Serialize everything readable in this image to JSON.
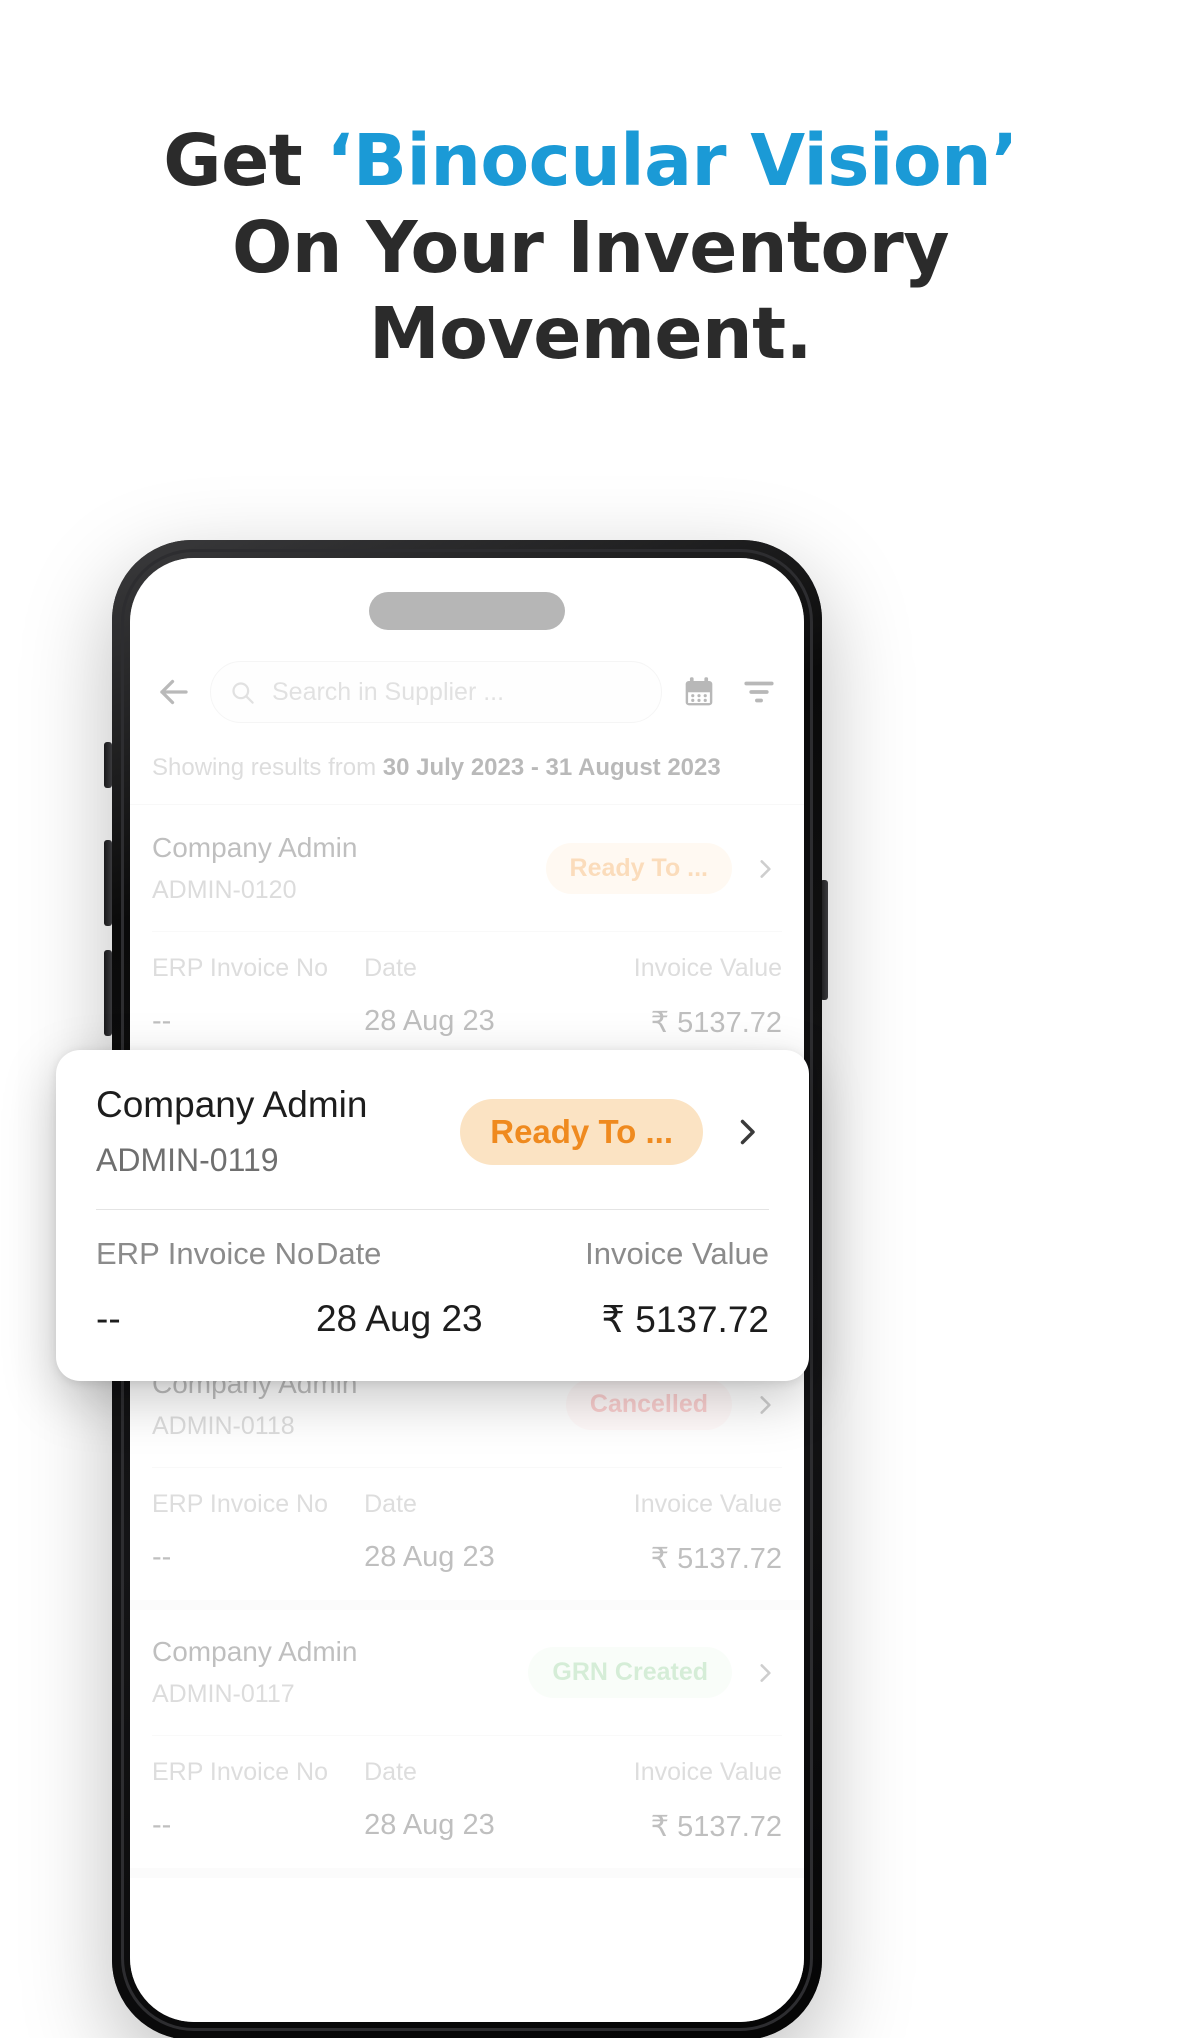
{
  "headline": {
    "line1_before": "Get ",
    "line1_accent": "‘Binocular Vision’",
    "line2": "On Your Inventory",
    "line3": "Movement.",
    "accent_color": "#1b9ad6",
    "text_color": "#2b2b2b"
  },
  "appbar": {
    "back_icon": "back-arrow-icon",
    "search_icon": "search-icon",
    "search_placeholder": "Search in Supplier ...",
    "search_value": "",
    "calendar_icon": "calendar-icon",
    "filter_icon": "filter-icon"
  },
  "results_summary": {
    "prefix": "Showing results from ",
    "range": "30 July 2023 - 31 August 2023"
  },
  "table_labels": {
    "erp_invoice_no": "ERP Invoice No",
    "date": "Date",
    "invoice_value": "Invoice Value"
  },
  "highlight_card": {
    "title": "Company Admin",
    "code": "ADMIN-0119",
    "status": "Ready To ...",
    "status_color": "#ef8a1f",
    "status_bg": "#fbe3c3",
    "chevron_icon": "chevron-right-icon",
    "erp_invoice_no_label": "ERP Invoice No",
    "erp_invoice_no_value": "--",
    "date_label": "Date",
    "date_value": "28 Aug 23",
    "invoice_value_label": "Invoice Value",
    "invoice_value_value": "₹ 5137.72"
  },
  "rows": [
    {
      "title": "Company Admin",
      "code": "ADMIN-0120",
      "status": "Ready To ...",
      "status_kind": "amber",
      "erp_invoice_no_label": "ERP Invoice No",
      "erp_invoice_no_value": "--",
      "date_label": "Date",
      "date_value": "28 Aug 23",
      "invoice_value_label": "Invoice Value",
      "invoice_value_value": "₹ 5137.72"
    },
    {
      "title": "Company Admin",
      "code": "ADMIN-0119",
      "status": "Ready To ...",
      "status_kind": "amber",
      "erp_invoice_no_label": "ERP Invoice No",
      "erp_invoice_no_value": "--",
      "date_label": "Date",
      "date_value": "28 Aug 23",
      "invoice_value_label": "Invoice Value",
      "invoice_value_value": "₹ 5137.72"
    },
    {
      "title": "Company Admin",
      "code": "ADMIN-0118",
      "status": "Cancelled",
      "status_kind": "red",
      "erp_invoice_no_label": "ERP Invoice No",
      "erp_invoice_no_value": "--",
      "date_label": "Date",
      "date_value": "28 Aug 23",
      "invoice_value_label": "Invoice Value",
      "invoice_value_value": "₹ 5137.72"
    },
    {
      "title": "Company Admin",
      "code": "ADMIN-0117",
      "status": "GRN Created",
      "status_kind": "green",
      "erp_invoice_no_label": "ERP Invoice No",
      "erp_invoice_no_value": "--",
      "date_label": "Date",
      "date_value": "28 Aug 23",
      "invoice_value_label": "Invoice Value",
      "invoice_value_value": "₹ 5137.72"
    }
  ]
}
